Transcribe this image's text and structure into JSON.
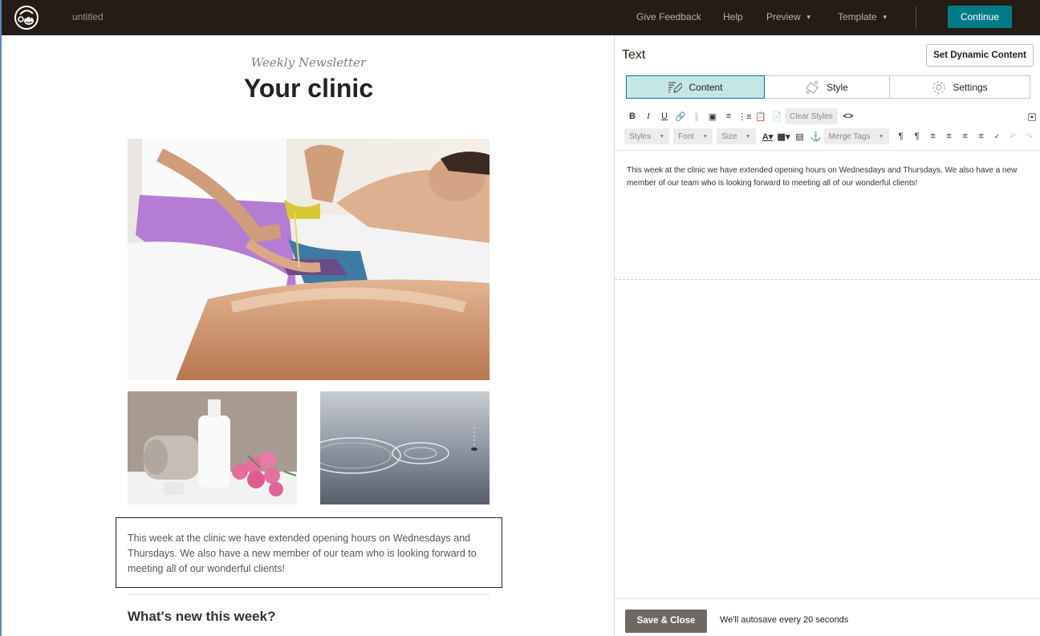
{
  "topbar": {
    "logo_icon": "mailchimp-freddie-logo",
    "doc_title": "untitled",
    "nav": [
      {
        "label": "Give Feedback",
        "has_dropdown": false
      },
      {
        "label": "Help",
        "has_dropdown": false
      },
      {
        "label": "Preview",
        "has_dropdown": true
      },
      {
        "label": "Template",
        "has_dropdown": true
      }
    ],
    "continue_label": "Continue",
    "accent_color": "#007c89",
    "bg_color": "#241c15"
  },
  "email": {
    "subtitle": "Weekly Newsletter",
    "title": "Your clinic",
    "hero_image": "massage-therapist-pouring-oil",
    "images": [
      "spa-towel-lotion-tulips",
      "water-ripples-drop"
    ],
    "body_text": "This week at the clinic we have extended opening hours on Wednesdays and Thursdays. We also have a new member of our team who is looking forward to meeting all of our wonderful clients!",
    "section_heading": "What's new this week?"
  },
  "panel": {
    "title": "Text",
    "dynamic_content_label": "Set Dynamic Content",
    "tabs": [
      {
        "label": "Content",
        "icon": "pencil-lines-icon",
        "active": true
      },
      {
        "label": "Style",
        "icon": "paint-bucket-icon",
        "active": false
      },
      {
        "label": "Settings",
        "icon": "gear-icon",
        "active": false
      }
    ],
    "toolbar": {
      "row1": {
        "bold": "B",
        "italic": "I",
        "underline": "U",
        "clear_styles": "Clear Styles",
        "source": "<>"
      },
      "row2": {
        "styles": "Styles",
        "font": "Font",
        "size": "Size",
        "merge_tags": "Merge Tags"
      }
    },
    "editor_text": "This week at the clinic we have extended opening hours on Wednesdays and Thursdays. We also have a new member of our team who is looking forward to meeting all of our wonderful clients!",
    "save_label": "Save & Close",
    "autosave_text": "We'll autosave every 20 seconds"
  }
}
